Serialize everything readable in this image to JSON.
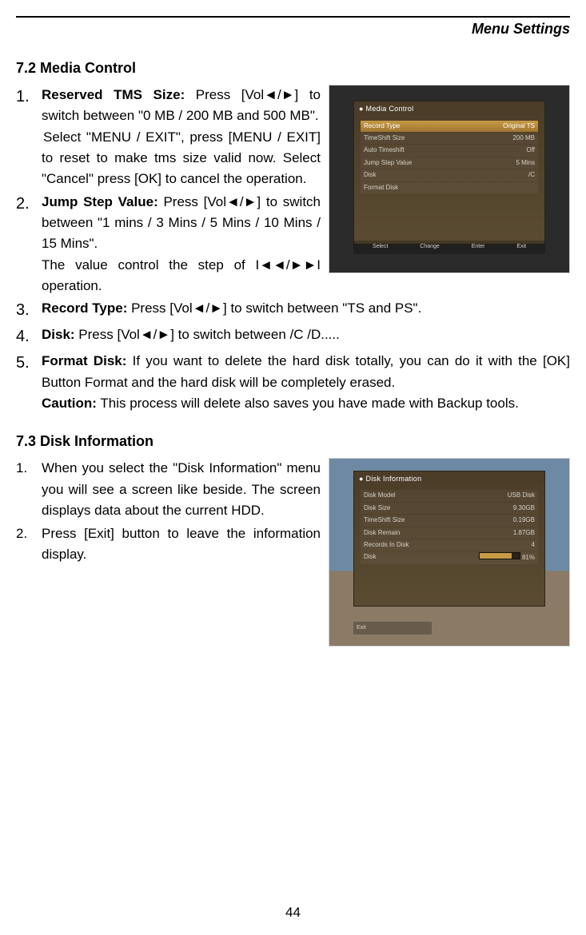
{
  "header": {
    "title": "Menu Settings"
  },
  "sec72": {
    "heading": "7.2  Media Control",
    "items": [
      {
        "num": "1.",
        "lead": "Reserved TMS Size:",
        "text1": " Press [Vol◄/►] to switch between \"0 MB / 200 MB and 500 MB\".",
        "text2": "Select \"MENU / EXIT\", press [MENU / EXIT] to reset to make tms size valid now. Select \"Cancel\" press [OK] to cancel the operation."
      },
      {
        "num": "2.",
        "lead": "Jump Step Value:",
        "text1": " Press [Vol◄/►] to switch between \"1 mins / 3 Mins / 5 Mins / 10 Mins / 15 Mins\".",
        "text2": "The value control the step of I◄◄/►►I operation."
      },
      {
        "num": "3.",
        "lead": "Record Type:",
        "text1": " Press [Vol◄/►] to switch between \"TS and PS\"."
      },
      {
        "num": "4.",
        "lead": "Disk:",
        "text1": " Press [Vol◄/►] to switch between /C /D....."
      },
      {
        "num": "5.",
        "lead": "Format Disk:",
        "text1": " If you want to delete the hard disk totally, you can do it with the [OK] Button Format and the hard disk will be completely erased.",
        "caution_lead": "Caution:",
        "caution_text": " This process will delete also saves you have made with Backup tools."
      }
    ],
    "screenshot": {
      "title": "Media Control",
      "rows": [
        {
          "label": "Record Type",
          "value": "Original TS",
          "sel": true
        },
        {
          "label": "TimeShift Size",
          "value": "200 MB",
          "sel": false
        },
        {
          "label": "Auto Timeshift",
          "value": "Off",
          "sel": false
        },
        {
          "label": "Jump Step Value",
          "value": "5 Mins",
          "sel": false
        },
        {
          "label": "Disk",
          "value": "/C",
          "sel": false
        },
        {
          "label": "Format Disk",
          "value": "",
          "sel": false
        }
      ],
      "footer": [
        "Select",
        "Change",
        "Enter",
        "Exit"
      ]
    }
  },
  "sec73": {
    "heading": "7.3  Disk Information",
    "items": [
      {
        "num": "1.",
        "text": "When you select the \"Disk Information\" menu you will see a screen like beside. The screen displays data about the current HDD."
      },
      {
        "num": "2.",
        "text": "Press [Exit] button to leave the information display."
      }
    ],
    "screenshot": {
      "title": "Disk Information",
      "rows": [
        {
          "label": "Disk Model",
          "value": "USB Disk"
        },
        {
          "label": "Disk Size",
          "value": "9.30GB"
        },
        {
          "label": "TimeShift Size",
          "value": "0.19GB"
        },
        {
          "label": "Disk Remain",
          "value": "1.87GB"
        },
        {
          "label": "Records In Disk",
          "value": "4"
        },
        {
          "label": "Disk",
          "value": "81%"
        }
      ],
      "footer": [
        "Exit"
      ]
    }
  },
  "page_number": "44"
}
